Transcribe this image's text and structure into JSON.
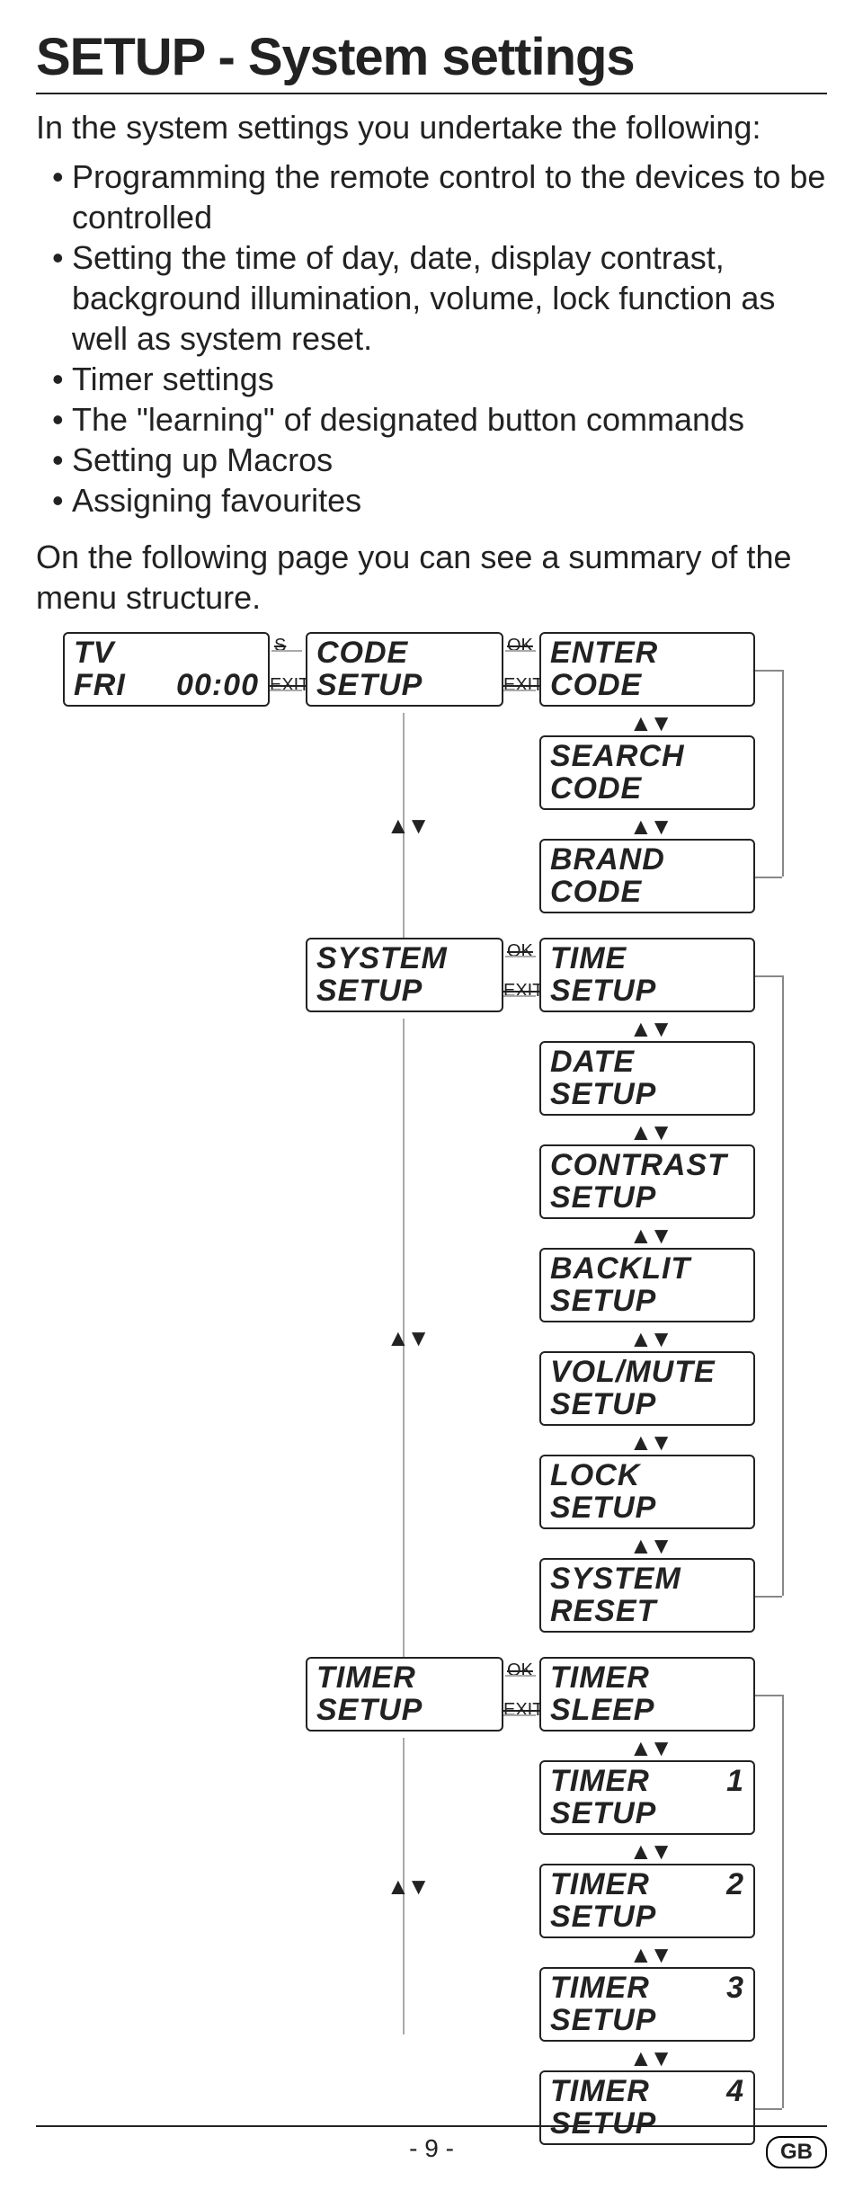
{
  "title": "SETUP - System settings",
  "intro": "In the system settings you undertake the following:",
  "bullets": [
    "Programming the remote control to the devices to be controlled",
    "Setting the time of day, date, display contrast, background illumination, volume, lock function as well as system reset.",
    "Timer settings",
    "The \"learning\" of designated button commands",
    "Setting up Macros",
    "Assigning favourites"
  ],
  "outro": "On the following page you can see a summary of the menu structure.",
  "labels": {
    "s": "S",
    "ok": "OK",
    "exit": "EXIT",
    "updown": "▲▼"
  },
  "diagram": {
    "root": {
      "l1a": "TV",
      "l2a": "FRI",
      "l2b": "00:00"
    },
    "code_setup": {
      "l1": "CODE",
      "l2": "SETUP"
    },
    "code_menu": [
      {
        "l1": "ENTER",
        "l2": "CODE"
      },
      {
        "l1": "SEARCH",
        "l2": "CODE"
      },
      {
        "l1": "BRAND",
        "l2": "CODE"
      }
    ],
    "system_setup": {
      "l1": "SYSTEM",
      "l2": "SETUP"
    },
    "system_menu": [
      {
        "l1": "TIME",
        "l2": "SETUP"
      },
      {
        "l1": "DATE",
        "l2": "SETUP"
      },
      {
        "l1": "CONTRAST",
        "l2": "SETUP"
      },
      {
        "l1": "BACKLIT",
        "l2": "SETUP"
      },
      {
        "l1": "VOL/MUTE",
        "l2": "SETUP"
      },
      {
        "l1": "LOCK",
        "l2": "SETUP"
      },
      {
        "l1": "SYSTEM",
        "l2": "RESET"
      }
    ],
    "timer_setup": {
      "l1": "TIMER",
      "l2": "SETUP"
    },
    "timer_menu": [
      {
        "l1": "TIMER",
        "l2": "SLEEP",
        "n": ""
      },
      {
        "l1": "TIMER",
        "l2": "SETUP",
        "n": "1"
      },
      {
        "l1": "TIMER",
        "l2": "SETUP",
        "n": "2"
      },
      {
        "l1": "TIMER",
        "l2": "SETUP",
        "n": "3"
      },
      {
        "l1": "TIMER",
        "l2": "SETUP",
        "n": "4"
      }
    ]
  },
  "footer": {
    "page": "- 9 -",
    "badge": "GB"
  }
}
